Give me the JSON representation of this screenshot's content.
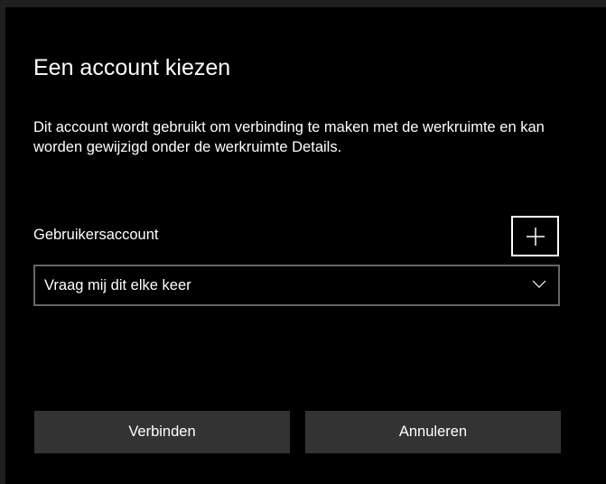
{
  "dialog": {
    "title": "Een account kiezen",
    "description": "Dit account wordt gebruikt om verbinding te maken met de werkruimte en kan worden gewijzigd onder de werkruimte Details.",
    "account_label": "Gebruikersaccount",
    "add_button_icon": "plus-icon",
    "account_select": {
      "value": "Vraag mij dit elke keer",
      "icon": "chevron-down-icon"
    },
    "buttons": {
      "connect_label": "Verbinden",
      "cancel_label": "Annuleren"
    }
  },
  "colors": {
    "dialog_background": "#000000",
    "page_background": "#1f1f1f",
    "button_background": "#333333",
    "select_border": "#666666",
    "text": "#ffffff"
  }
}
